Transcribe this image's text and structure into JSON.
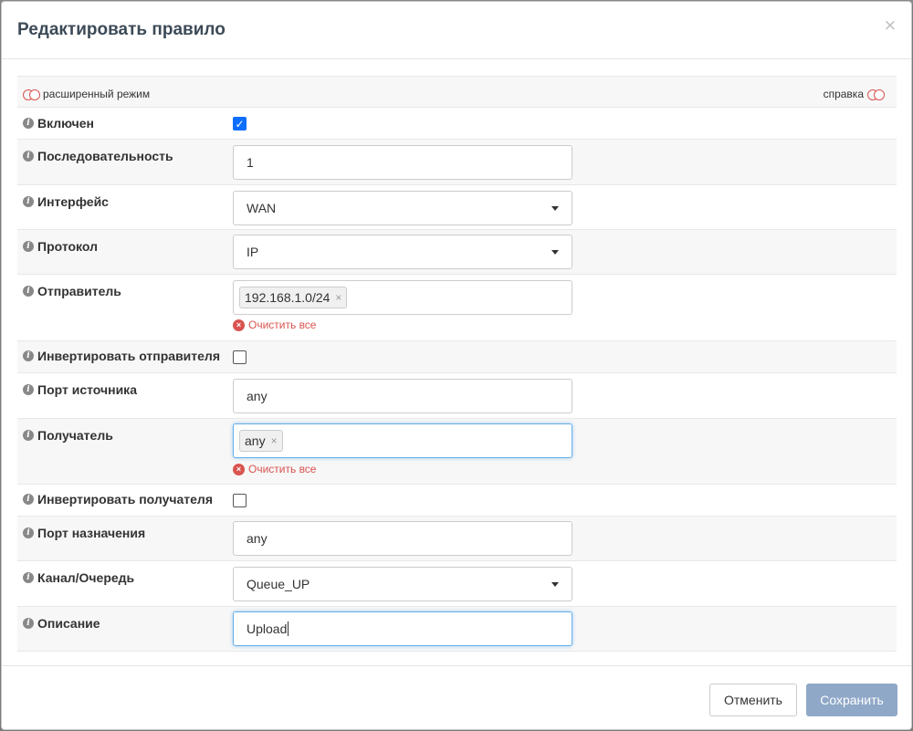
{
  "dialog": {
    "title": "Редактировать правило",
    "close_label": "×"
  },
  "toggles": {
    "advanced_mode": "расширенный режим",
    "help": "справка"
  },
  "fields": {
    "enabled": {
      "label": "Включен",
      "checked": true
    },
    "sequence": {
      "label": "Последовательность",
      "value": "1"
    },
    "interface": {
      "label": "Интерфейс",
      "value": "WAN"
    },
    "protocol": {
      "label": "Протокол",
      "value": "IP"
    },
    "source": {
      "label": "Отправитель",
      "tokens": [
        "192.168.1.0/24"
      ],
      "clear_label": "Очистить все"
    },
    "invert_source": {
      "label": "Инвертировать отправителя",
      "checked": false
    },
    "source_port": {
      "label": "Порт источника",
      "value": "any"
    },
    "destination": {
      "label": "Получатель",
      "tokens": [
        "any"
      ],
      "clear_label": "Очистить все"
    },
    "invert_destination": {
      "label": "Инвертировать получателя",
      "checked": false
    },
    "destination_port": {
      "label": "Порт назначения",
      "value": "any"
    },
    "pipe_queue": {
      "label": "Канал/Очередь",
      "value": "Queue_UP"
    },
    "description": {
      "label": "Описание",
      "value": "Upload"
    }
  },
  "footer": {
    "cancel_label": "Отменить",
    "save_label": "Сохранить"
  },
  "icons": {
    "info": "info-icon",
    "clear": "clear-icon",
    "toggle": "toggle-icon",
    "select_arrow": "chevron-down-icon"
  },
  "colors": {
    "primary_disabled": "#90a8c8",
    "danger": "#d9534f",
    "focus_border": "#66afe9",
    "checkbox_checked": "#0d6efd"
  }
}
